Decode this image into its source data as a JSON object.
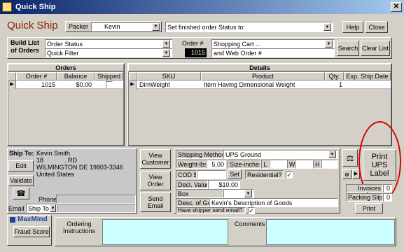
{
  "window": {
    "title": "Quick Ship"
  },
  "header": {
    "app_title": "Quick Ship",
    "packer_label": "Packer",
    "packer_value": "Kevin",
    "status_placeholder": "Set finished order Status to:",
    "help_label": "Help",
    "close_label": "Close"
  },
  "build": {
    "label_line1": "Build List",
    "label_line2": "of Orders",
    "order_status": "Order Status",
    "quick_filter": "Quick Filter",
    "order_num_label": "Order #",
    "order_num_value": "1015",
    "shopping_cart": "Shopping Cart ...",
    "web_order": "and Web Order #",
    "search_label": "Search",
    "clear_label": "Clear List"
  },
  "orders": {
    "title": "Orders",
    "columns": [
      "Order #",
      "Balance",
      "Shipped"
    ],
    "rows": [
      {
        "order": "1015",
        "balance": "$0.00"
      }
    ]
  },
  "details": {
    "title": "Details",
    "columns": [
      "SKU",
      "Product",
      "Qty.",
      "Exp. Ship Date"
    ],
    "rows": [
      {
        "sku": "DimWeight",
        "product": "Item Having Dimensional Weight",
        "qty": "1",
        "date": ""
      }
    ]
  },
  "ship_to": {
    "label": "Ship To:",
    "lines": [
      "Kevin Smith",
      "18            . RD",
      "WILMINGTON DE 19803-3346",
      "United States"
    ],
    "edit_label": "Edit",
    "validate_label": "Validate",
    "phone_label": "Phone",
    "email_label": "Email",
    "email_target": "Ship To"
  },
  "actions": {
    "view_customer": [
      "View",
      "Customer"
    ],
    "view_order": [
      "View",
      "Order"
    ],
    "send_email": [
      "Send",
      "Email"
    ]
  },
  "shipping": {
    "method_label": "Shipping Method",
    "method_value": "UPS Ground",
    "weight_label": "Weight-lbs.",
    "weight_value": "5.00",
    "size_label": "Size-inches",
    "l_label": "L",
    "w_label": "W",
    "h_label": "H",
    "cod_label": "COD $",
    "set_label": "Set",
    "residential_label": "Residential?",
    "residential_checked": "✓",
    "decl_label": "Decl. Value",
    "decl_value": "$10.00",
    "box_label": "Box",
    "desc_label": "Desc. of Goods",
    "desc_value": "Kevin's Description of Goods",
    "send_email_label": "Have shipper send email?",
    "send_email_checked": "✓"
  },
  "print": {
    "o_label": "o",
    "print_ups_line1": "Print",
    "print_ups_line2": "UPS",
    "print_ups_line3": "Label",
    "invoices_label": "Invoices",
    "invoices_value": "0",
    "packing_label": "Packing Slips",
    "packing_value": "0",
    "print_label": "Print"
  },
  "bottom": {
    "maxmind_label": "MaxMind",
    "fraud_label": "Fraud Score",
    "ordering_line1": "Ordering",
    "ordering_line2": "Instructions",
    "comments_label": "Comments"
  },
  "colors": {
    "title_bar_start": "#0a246a",
    "title_bar_end": "#a6caf0",
    "app_title": "#8b2500",
    "panel_bg": "#d4d0c8",
    "cyan_field": "#ccffff",
    "highlight_circle": "#dd0000"
  }
}
